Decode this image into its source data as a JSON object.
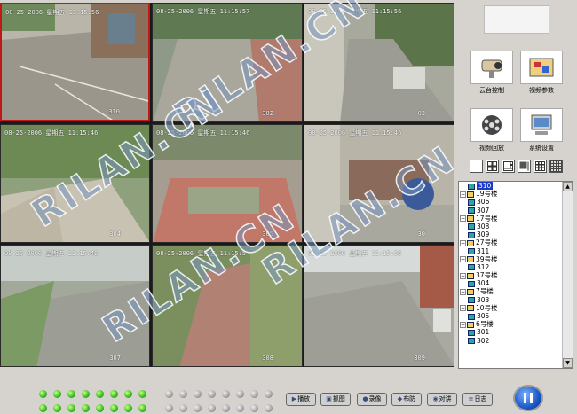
{
  "cameras": [
    {
      "ts": "08-25-2006 星期五 11:15:56",
      "num": "310"
    },
    {
      "ts": "08-25-2006 星期五 11:15:57",
      "num": "302"
    },
    {
      "ts": "08-25-2006 星期五 11:15:56",
      "num": "03"
    },
    {
      "ts": "08-25-2006 星期五 11:15:46",
      "num": "304"
    },
    {
      "ts": "08-25-2006 星期五 11:15:46",
      "num": "305"
    },
    {
      "ts": "08-25-2006 星期五 11:15:46",
      "num": "30"
    },
    {
      "ts": "08-25-2006 星期五 11:15:46",
      "num": "307"
    },
    {
      "ts": "08-25-2006 星期五 11:15:5",
      "num": "308"
    },
    {
      "ts": "08-25-2006 星期五 11:15:56",
      "num": "309"
    }
  ],
  "watermark": "RILAN.CN",
  "tools": [
    {
      "label": "云台控制",
      "icon": "ptz-camera-icon"
    },
    {
      "label": "视频参数",
      "icon": "video-params-icon"
    },
    {
      "label": "视频回放",
      "icon": "film-reel-icon"
    },
    {
      "label": "系统设置",
      "icon": "computer-settings-icon"
    }
  ],
  "layouts": [
    "single-view",
    "quad-view",
    "six-view",
    "eight-view",
    "nine-view",
    "sixteen-view"
  ],
  "tree": [
    {
      "type": "child",
      "label": "310",
      "selected": true
    },
    {
      "type": "group",
      "label": "19号楼"
    },
    {
      "type": "child",
      "label": "306"
    },
    {
      "type": "child",
      "label": "307"
    },
    {
      "type": "group",
      "label": "17号楼"
    },
    {
      "type": "child",
      "label": "308"
    },
    {
      "type": "child",
      "label": "309"
    },
    {
      "type": "group",
      "label": "27号楼"
    },
    {
      "type": "child",
      "label": "311"
    },
    {
      "type": "group",
      "label": "39号楼"
    },
    {
      "type": "child",
      "label": "312"
    },
    {
      "type": "group",
      "label": "37号楼"
    },
    {
      "type": "child",
      "label": "304"
    },
    {
      "type": "group",
      "label": "7号楼"
    },
    {
      "type": "child",
      "label": "303"
    },
    {
      "type": "group",
      "label": "10号楼"
    },
    {
      "type": "child",
      "label": "305"
    },
    {
      "type": "group",
      "label": "6号楼"
    },
    {
      "type": "child",
      "label": "301"
    },
    {
      "type": "child",
      "label": "302"
    }
  ],
  "controls": [
    {
      "label": "播放",
      "icon": "play-icon"
    },
    {
      "label": "抓图",
      "icon": "snapshot-icon"
    },
    {
      "label": "录像",
      "icon": "record-icon"
    },
    {
      "label": "布防",
      "icon": "arm-icon"
    },
    {
      "label": "对讲",
      "icon": "intercom-icon"
    },
    {
      "label": "日志",
      "icon": "log-icon"
    }
  ],
  "leds_top": [
    "on",
    "on",
    "on",
    "on",
    "on",
    "on",
    "on",
    "on",
    "off",
    "off",
    "off",
    "off",
    "off",
    "off",
    "off",
    "off"
  ],
  "leds_bottom": [
    "on",
    "on",
    "on",
    "on",
    "on",
    "on",
    "on",
    "on",
    "off",
    "off",
    "off",
    "off",
    "off",
    "off",
    "off",
    "off"
  ],
  "colors": {
    "led_on": "#3ec12a",
    "led_off": "#aaaaaa",
    "selected": "#1a3cc8",
    "panel": "#d6d3ce"
  }
}
